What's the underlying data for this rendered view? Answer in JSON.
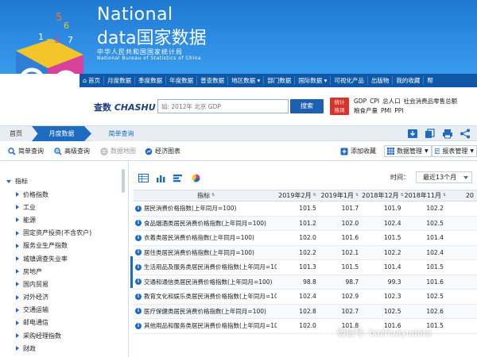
{
  "banner": {
    "national": "National",
    "data_en": "data",
    "data_cn": "国家数据",
    "bureau_cn": "中华人民共和国国家统计局",
    "bureau_en": "National Bureau of Statistics of China"
  },
  "nav": {
    "items": [
      "首页",
      "月度数据",
      "季度数据",
      "年度数据",
      "普查数据",
      "地区数据 ▾",
      "部门数据",
      "国际数据 ▾",
      "可视化产品",
      "出版物",
      "我的收藏",
      "帮"
    ]
  },
  "search": {
    "chashu_cn": "查数",
    "chashu_en": "CHASHU",
    "placeholder": "如: 2012年 北京 GDP",
    "button": "搜索",
    "hot_badge_line1": "统计",
    "hot_badge_line2": "热词",
    "hot_words": [
      "GDP",
      "CPI",
      "总人口",
      "社会消费品零售总额",
      "粮食产量",
      "PMI",
      "PPI"
    ]
  },
  "tabs": {
    "home": "首页",
    "monthly": "月度数据",
    "simple": "简单查询"
  },
  "toolbar": {
    "simple_query": "简单查询",
    "advanced_query": "高级查询",
    "data_map": "数据地图",
    "economic_chart": "经济图表",
    "add_favorite": "添加收藏",
    "data_manage": "数据管理",
    "report_manage": "报表管理"
  },
  "sidebar": {
    "root": "指标",
    "items": [
      "价格指数",
      "工业",
      "能源",
      "固定资产投资(不含农户)",
      "服务业生产指数",
      "城镇调查失业率",
      "房地产",
      "国内贸易",
      "对外经济",
      "交通运输",
      "邮电通信",
      "采购经理指数",
      "财政",
      "金融"
    ]
  },
  "main": {
    "time_label": "时间：",
    "time_value": "最近13个月",
    "headers": [
      "指标",
      "2019年2月",
      "2019年1月",
      "2018年12月",
      "2018年11月",
      "20"
    ],
    "rows": [
      {
        "name": "居民消费价格指数(上年同月=100)",
        "v": [
          "101.5",
          "101.7",
          "101.9",
          "102.2",
          ""
        ]
      },
      {
        "name": "食品烟酒类居民消费价格指数(上年同月=100)",
        "v": [
          "101.2",
          "102.0",
          "102.4",
          "102.5",
          ""
        ]
      },
      {
        "name": "衣着类居民消费价格指数(上年同月=100)",
        "v": [
          "102.0",
          "101.6",
          "101.5",
          "101.4",
          ""
        ]
      },
      {
        "name": "居住类居民消费价格指数(上年同月=100)",
        "v": [
          "102.2",
          "102.1",
          "102.2",
          "102.4",
          ""
        ]
      },
      {
        "name": "生活用品及服务类居民消费价格指数(上年同月=100)",
        "v": [
          "101.3",
          "101.5",
          "101.4",
          "101.5",
          ""
        ]
      },
      {
        "name": "交通和通信类居民消费价格指数(上年同月=100)",
        "v": [
          "98.8",
          "98.7",
          "99.3",
          "101.6",
          ""
        ]
      },
      {
        "name": "教育文化和娱乐类居民消费价格指数(上年同月=100)",
        "v": [
          "102.4",
          "102.9",
          "102.3",
          "102.5",
          ""
        ]
      },
      {
        "name": "医疗保健类居民消费价格指数(上年同月=100)",
        "v": [
          "102.8",
          "102.7",
          "102.5",
          "102.6",
          ""
        ]
      },
      {
        "name": "其他用品和服务类居民消费价格指数(上年同月=100)",
        "v": [
          "102.0",
          "101.8",
          "101.6",
          "101.5",
          ""
        ]
      }
    ]
  },
  "watermark": "微信号: bazhuayudata",
  "colors": {
    "banner": "#2f8ee3",
    "nav": "#0f58a8",
    "accent": "#1e6cc2",
    "hot_badge": "#d9342b"
  }
}
